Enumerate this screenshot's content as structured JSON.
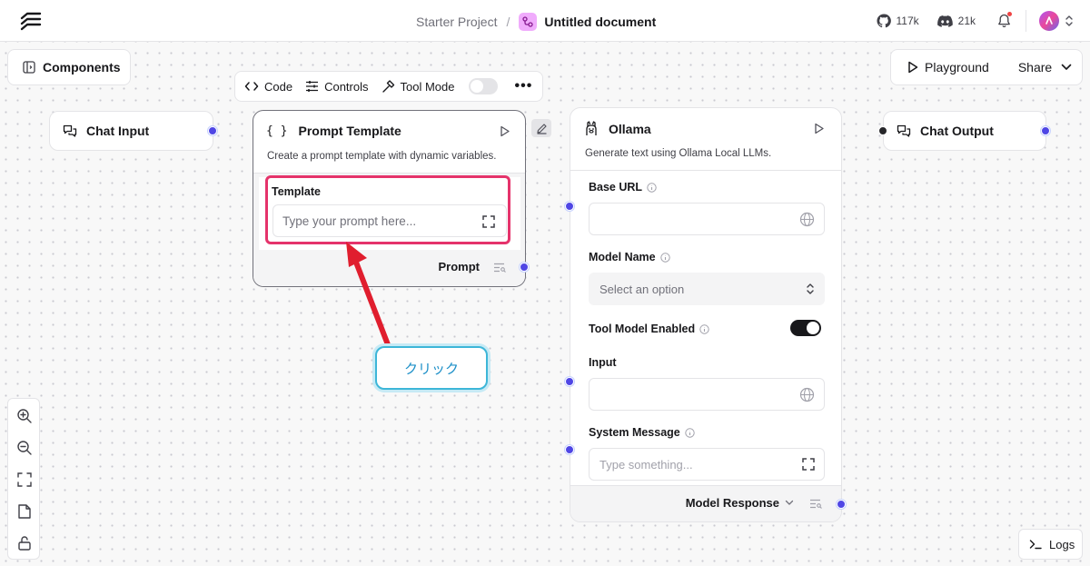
{
  "header": {
    "project": "Starter Project",
    "separator": "/",
    "document_title": "Untitled document",
    "github_stars": "117k",
    "discord_members": "21k"
  },
  "toolbar_left": {
    "components_label": "Components"
  },
  "toolbar_right": {
    "playground_label": "Playground",
    "share_label": "Share"
  },
  "node_toolbar": {
    "code_label": "Code",
    "controls_label": "Controls",
    "tool_mode_label": "Tool Mode",
    "more_label": "•••"
  },
  "nodes": {
    "chat_input": {
      "title": "Chat Input"
    },
    "chat_output": {
      "title": "Chat Output"
    },
    "prompt_template": {
      "icon_text": "{ }",
      "title": "Prompt Template",
      "description": "Create a prompt template with dynamic variables.",
      "template_label": "Template",
      "template_placeholder": "Type your prompt here...",
      "output_label": "Prompt"
    },
    "ollama": {
      "title": "Ollama",
      "description": "Generate text using Ollama Local LLMs.",
      "base_url_label": "Base URL",
      "model_name_label": "Model Name",
      "model_name_placeholder": "Select an option",
      "tool_model_label": "Tool Model Enabled",
      "input_label": "Input",
      "system_message_label": "System Message",
      "system_message_placeholder": "Type something...",
      "output_label": "Model Response"
    }
  },
  "callout": {
    "text": "クリック"
  },
  "logs": {
    "label": "Logs"
  },
  "colors": {
    "handle": "#4f46e5",
    "highlight": "#e5336b",
    "callout_border": "#3db6d8",
    "doc_icon": "#f0abfc"
  }
}
